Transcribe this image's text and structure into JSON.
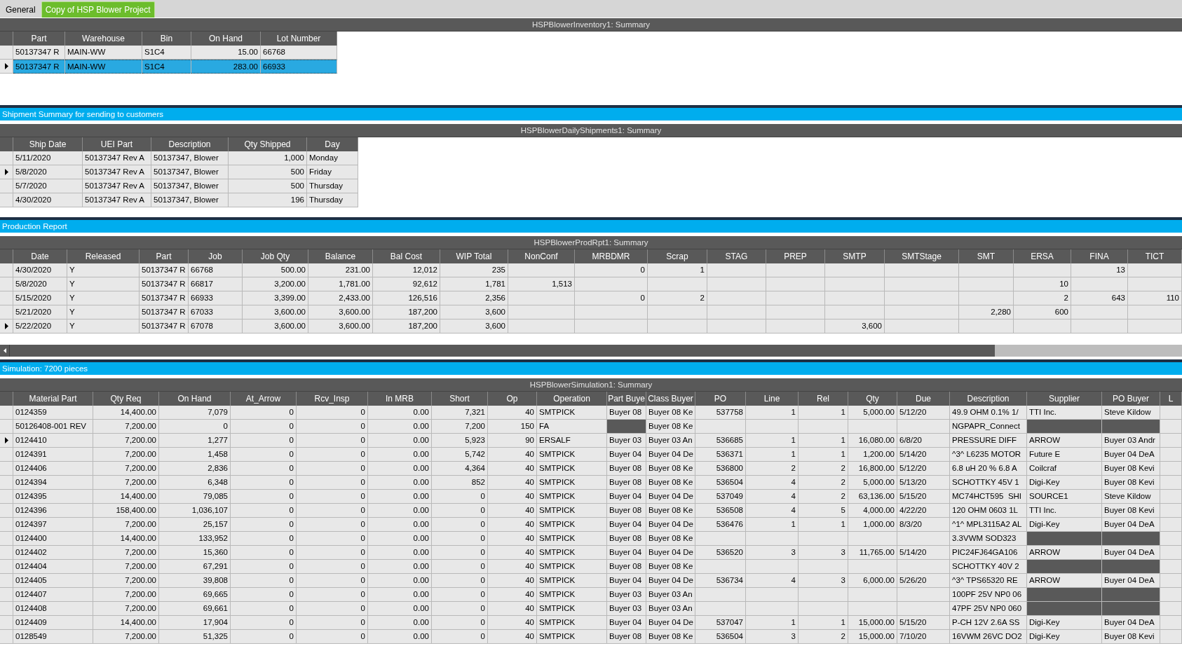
{
  "tabs": [
    {
      "label": "General",
      "selected": false
    },
    {
      "label": "Copy of HSP Blower Project",
      "selected": true
    }
  ],
  "sections": [
    {
      "grid": {
        "title": "HSPBlowerInventory1: Summary",
        "columns": [
          {
            "label": "Part",
            "numeric": false
          },
          {
            "label": "Warehouse",
            "numeric": false
          },
          {
            "label": "Bin",
            "numeric": false
          },
          {
            "label": "On Hand",
            "numeric": true
          },
          {
            "label": "Lot Number",
            "numeric": false
          }
        ],
        "rows": [
          {
            "current": false,
            "selected": false,
            "cells": [
              "50137347 R",
              "MAIN-WW",
              "S1C4",
              "15.00",
              "66768"
            ]
          },
          {
            "current": true,
            "selected": true,
            "cells": [
              "50137347 R",
              "MAIN-WW",
              "S1C4",
              "283.00",
              "66933"
            ]
          }
        ]
      }
    },
    {
      "heading": "Shipment Summary for sending to customers",
      "grid": {
        "title": "HSPBlowerDailyShipments1: Summary",
        "columns": [
          {
            "label": "Ship Date",
            "numeric": false
          },
          {
            "label": "UEI Part",
            "numeric": false
          },
          {
            "label": "Description",
            "numeric": false
          },
          {
            "label": "Qty Shipped",
            "numeric": true
          },
          {
            "label": "Day",
            "numeric": false
          }
        ],
        "rows": [
          {
            "current": false,
            "selected": false,
            "cells": [
              "5/11/2020",
              "50137347 Rev A",
              "50137347, Blower",
              "1,000",
              "Monday"
            ]
          },
          {
            "current": true,
            "selected": false,
            "cells": [
              "5/8/2020",
              "50137347 Rev A",
              "50137347, Blower",
              "500",
              "Friday"
            ]
          },
          {
            "current": false,
            "selected": false,
            "cells": [
              "5/7/2020",
              "50137347 Rev A",
              "50137347, Blower",
              "500",
              "Thursday"
            ]
          },
          {
            "current": false,
            "selected": false,
            "cells": [
              "4/30/2020",
              "50137347 Rev A",
              "50137347, Blower",
              "196",
              "Thursday"
            ]
          }
        ]
      }
    },
    {
      "heading": "Production Report",
      "grid": {
        "title": "HSPBlowerProdRpt1: Summary",
        "horizontal_scrollbar": true,
        "columns": [
          {
            "label": "Date",
            "numeric": false
          },
          {
            "label": "Released",
            "numeric": false
          },
          {
            "label": "Part",
            "numeric": false
          },
          {
            "label": "Job",
            "numeric": false
          },
          {
            "label": "Job Qty",
            "numeric": true
          },
          {
            "label": "Balance",
            "numeric": true
          },
          {
            "label": "Bal Cost",
            "numeric": true
          },
          {
            "label": "WIP Total",
            "numeric": true
          },
          {
            "label": "NonConf",
            "numeric": true
          },
          {
            "label": "MRBDMR",
            "numeric": true
          },
          {
            "label": "Scrap",
            "numeric": true
          },
          {
            "label": "STAG"
          },
          {
            "label": "PREP"
          },
          {
            "label": "SMTP",
            "numeric": true
          },
          {
            "label": "SMTStage"
          },
          {
            "label": "SMT",
            "numeric": true
          },
          {
            "label": "ERSA",
            "numeric": true
          },
          {
            "label": "FINA",
            "numeric": true
          },
          {
            "label": "TICT",
            "numeric": true
          }
        ],
        "rows": [
          {
            "current": false,
            "selected": false,
            "cells": [
              "4/30/2020",
              "Y",
              "50137347 R",
              "66768",
              "500.00",
              "231.00",
              "12,012",
              "235",
              null,
              "0",
              "1",
              null,
              null,
              null,
              null,
              null,
              null,
              "13",
              null
            ]
          },
          {
            "current": false,
            "selected": false,
            "cells": [
              "5/8/2020",
              "Y",
              "50137347 R",
              "66817",
              "3,200.00",
              "1,781.00",
              "92,612",
              "1,781",
              "1,513",
              null,
              null,
              null,
              null,
              null,
              null,
              null,
              "10",
              null,
              null
            ]
          },
          {
            "current": false,
            "selected": false,
            "cells": [
              "5/15/2020",
              "Y",
              "50137347 R",
              "66933",
              "3,399.00",
              "2,433.00",
              "126,516",
              "2,356",
              null,
              "0",
              "2",
              null,
              null,
              null,
              null,
              null,
              "2",
              "643",
              "110"
            ]
          },
          {
            "current": false,
            "selected": false,
            "cells": [
              "5/21/2020",
              "Y",
              "50137347 R",
              "67033",
              "3,600.00",
              "3,600.00",
              "187,200",
              "3,600",
              null,
              null,
              null,
              null,
              null,
              null,
              null,
              "2,280",
              "600",
              null,
              null
            ]
          },
          {
            "current": true,
            "selected": false,
            "cells": [
              "5/22/2020",
              "Y",
              "50137347 R",
              "67078",
              "3,600.00",
              "3,600.00",
              "187,200",
              "3,600",
              null,
              null,
              null,
              null,
              null,
              "3,600",
              null,
              null,
              null,
              null,
              null
            ]
          }
        ]
      }
    },
    {
      "heading": "Simulation: 7200 pieces",
      "grid": {
        "title": "HSPBlowerSimulation1: Summary",
        "columns": [
          {
            "label": "Material Part",
            "numeric": false
          },
          {
            "label": "Qty Req",
            "numeric": true
          },
          {
            "label": "On Hand",
            "numeric": true
          },
          {
            "label": "At_Arrow",
            "numeric": true
          },
          {
            "label": "Rcv_Insp",
            "numeric": true
          },
          {
            "label": "In MRB",
            "numeric": true
          },
          {
            "label": "Short",
            "numeric": true
          },
          {
            "label": "Op",
            "numeric": true
          },
          {
            "label": "Operation",
            "numeric": false
          },
          {
            "label": "Part Buye",
            "numeric": false
          },
          {
            "label": "Class Buyer",
            "numeric": false
          },
          {
            "label": "PO",
            "numeric": true
          },
          {
            "label": "Line",
            "numeric": true
          },
          {
            "label": "Rel",
            "numeric": true
          },
          {
            "label": "Qty",
            "numeric": true
          },
          {
            "label": "Due",
            "numeric": false
          },
          {
            "label": "Description",
            "numeric": false
          },
          {
            "label": "Supplier",
            "numeric": false
          },
          {
            "label": "PO Buyer",
            "numeric": false
          },
          {
            "label": "L"
          }
        ],
        "rows": [
          {
            "current": false,
            "selected": false,
            "cells": [
              "0124359",
              "14,400.00",
              "7,079",
              "0",
              "0",
              "0.00",
              "7,321",
              "40",
              "SMTPICK",
              "Buyer 08",
              "Buyer 08 Ke",
              "537758",
              "1",
              "1",
              "5,000.00",
              "5/12/20",
              "49.9 OHM 0.1% 1/",
              "TTI Inc.",
              "Steve Kildow",
              null
            ]
          },
          {
            "current": false,
            "selected": false,
            "cells": [
              "50126408-001 REV",
              "7,200.00",
              "0",
              "0",
              "0",
              "0.00",
              "7,200",
              "150",
              "FA",
              {
                "shaded": true
              },
              "Buyer 08 Ke",
              null,
              null,
              null,
              null,
              null,
              "NGPAPR_Connect",
              {
                "shaded": true
              },
              {
                "shaded": true
              },
              null
            ]
          },
          {
            "current": true,
            "selected": false,
            "cells": [
              "0124410",
              "7,200.00",
              "1,277",
              "0",
              "0",
              "0.00",
              "5,923",
              "90",
              "ERSALF",
              "Buyer 03",
              "Buyer 03 An",
              "536685",
              "1",
              "1",
              "16,080.00",
              "6/8/20",
              "PRESSURE DIFF",
              "ARROW",
              "Buyer 03 Andr",
              null
            ]
          },
          {
            "current": false,
            "selected": false,
            "cells": [
              "0124391",
              "7,200.00",
              "1,458",
              "0",
              "0",
              "0.00",
              "5,742",
              "40",
              "SMTPICK",
              "Buyer 04",
              "Buyer 04 De",
              "536371",
              "1",
              "1",
              "1,200.00",
              "5/14/20",
              "^3^ L6235 MOTOR",
              "Future E",
              "Buyer 04 DeA",
              null
            ]
          },
          {
            "current": false,
            "selected": false,
            "cells": [
              "0124406",
              "7,200.00",
              "2,836",
              "0",
              "0",
              "0.00",
              "4,364",
              "40",
              "SMTPICK",
              "Buyer 08",
              "Buyer 08 Ke",
              "536800",
              "2",
              "2",
              "16,800.00",
              "5/12/20",
              "6.8 uH 20 % 6.8 A",
              "Coilcraf",
              "Buyer 08 Kevi",
              null
            ]
          },
          {
            "current": false,
            "selected": false,
            "cells": [
              "0124394",
              "7,200.00",
              "6,348",
              "0",
              "0",
              "0.00",
              "852",
              "40",
              "SMTPICK",
              "Buyer 08",
              "Buyer 08 Ke",
              "536504",
              "4",
              "2",
              "5,000.00",
              "5/13/20",
              "SCHOTTKY 45V 1",
              "Digi-Key",
              "Buyer 08 Kevi",
              null
            ]
          },
          {
            "current": false,
            "selected": false,
            "cells": [
              "0124395",
              "14,400.00",
              "79,085",
              "0",
              "0",
              "0.00",
              "0",
              "40",
              "SMTPICK",
              "Buyer 04",
              "Buyer 04 De",
              "537049",
              "4",
              "2",
              "63,136.00",
              "5/15/20",
              "MC74HCT595  SHI",
              "SOURCE1",
              "Steve Kildow",
              null
            ]
          },
          {
            "current": false,
            "selected": false,
            "cells": [
              "0124396",
              "158,400.00",
              "1,036,107",
              "0",
              "0",
              "0.00",
              "0",
              "40",
              "SMTPICK",
              "Buyer 08",
              "Buyer 08 Ke",
              "536508",
              "4",
              "5",
              "4,000.00",
              "4/22/20",
              "120 OHM 0603 1L",
              "TTI Inc.",
              "Buyer 08 Kevi",
              null
            ]
          },
          {
            "current": false,
            "selected": false,
            "cells": [
              "0124397",
              "7,200.00",
              "25,157",
              "0",
              "0",
              "0.00",
              "0",
              "40",
              "SMTPICK",
              "Buyer 04",
              "Buyer 04 De",
              "536476",
              "1",
              "1",
              "1,000.00",
              "8/3/20",
              "^1^ MPL3115A2 AL",
              "Digi-Key",
              "Buyer 04 DeA",
              null
            ]
          },
          {
            "current": false,
            "selected": false,
            "cells": [
              "0124400",
              "14,400.00",
              "133,952",
              "0",
              "0",
              "0.00",
              "0",
              "40",
              "SMTPICK",
              "Buyer 08",
              "Buyer 08 Ke",
              null,
              null,
              null,
              null,
              null,
              "3.3VWM SOD323",
              {
                "shaded": true
              },
              {
                "shaded": true
              },
              null
            ]
          },
          {
            "current": false,
            "selected": false,
            "cells": [
              "0124402",
              "7,200.00",
              "15,360",
              "0",
              "0",
              "0.00",
              "0",
              "40",
              "SMTPICK",
              "Buyer 04",
              "Buyer 04 De",
              "536520",
              "3",
              "3",
              "11,765.00",
              "5/14/20",
              "PIC24FJ64GA106",
              "ARROW",
              "Buyer 04 DeA",
              null
            ]
          },
          {
            "current": false,
            "selected": false,
            "cells": [
              "0124404",
              "7,200.00",
              "67,291",
              "0",
              "0",
              "0.00",
              "0",
              "40",
              "SMTPICK",
              "Buyer 08",
              "Buyer 08 Ke",
              null,
              null,
              null,
              null,
              null,
              "SCHOTTKY 40V 2",
              {
                "shaded": true
              },
              {
                "shaded": true
              },
              null
            ]
          },
          {
            "current": false,
            "selected": false,
            "cells": [
              "0124405",
              "7,200.00",
              "39,808",
              "0",
              "0",
              "0.00",
              "0",
              "40",
              "SMTPICK",
              "Buyer 04",
              "Buyer 04 De",
              "536734",
              "4",
              "3",
              "6,000.00",
              "5/26/20",
              "^3^ TPS65320 RE",
              "ARROW",
              "Buyer 04 DeA",
              null
            ]
          },
          {
            "current": false,
            "selected": false,
            "cells": [
              "0124407",
              "7,200.00",
              "69,665",
              "0",
              "0",
              "0.00",
              "0",
              "40",
              "SMTPICK",
              "Buyer 03",
              "Buyer 03 An",
              null,
              null,
              null,
              null,
              null,
              "100PF 25V NP0 06",
              {
                "shaded": true
              },
              {
                "shaded": true
              },
              null
            ]
          },
          {
            "current": false,
            "selected": false,
            "cells": [
              "0124408",
              "7,200.00",
              "69,661",
              "0",
              "0",
              "0.00",
              "0",
              "40",
              "SMTPICK",
              "Buyer 03",
              "Buyer 03 An",
              null,
              null,
              null,
              null,
              null,
              "47PF 25V NP0 060",
              {
                "shaded": true
              },
              {
                "shaded": true
              },
              null
            ]
          },
          {
            "current": false,
            "selected": false,
            "cells": [
              "0124409",
              "14,400.00",
              "17,904",
              "0",
              "0",
              "0.00",
              "0",
              "40",
              "SMTPICK",
              "Buyer 04",
              "Buyer 04 De",
              "537047",
              "1",
              "1",
              "15,000.00",
              "5/15/20",
              "P-CH 12V 2.6A SS",
              "Digi-Key",
              "Buyer 04 DeA",
              null
            ]
          },
          {
            "current": false,
            "selected": false,
            "cells": [
              "0128549",
              "7,200.00",
              "51,325",
              "0",
              "0",
              "0.00",
              "0",
              "40",
              "SMTPICK",
              "Buyer 08",
              "Buyer 08 Ke",
              "536504",
              "3",
              "2",
              "15,000.00",
              "7/10/20",
              "16VWM 26VC DO2",
              "Digi-Key",
              "Buyer 08 Kevi",
              null
            ]
          }
        ]
      }
    }
  ]
}
